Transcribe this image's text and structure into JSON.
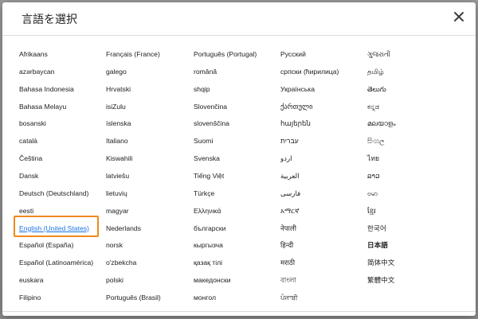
{
  "dialog": {
    "title": "言語を選択",
    "close_icon": "close-icon"
  },
  "colors": {
    "link": "#1a73e8",
    "highlight": "#f0891c",
    "text": "#202124"
  },
  "columns": [
    {
      "items": [
        {
          "label": "Afrikaans"
        },
        {
          "label": "azərbaycan"
        },
        {
          "label": "Bahasa Indonesia"
        },
        {
          "label": "Bahasa Melayu"
        },
        {
          "label": "bosanski"
        },
        {
          "label": "català"
        },
        {
          "label": "Čeština"
        },
        {
          "label": "Dansk"
        },
        {
          "label": "Deutsch (Deutschland)"
        },
        {
          "label": "eesti"
        },
        {
          "label": "English (United States)",
          "selected": true
        },
        {
          "label": "Español (España)"
        },
        {
          "label": "Español (Latinoamérica)"
        },
        {
          "label": "euskara"
        },
        {
          "label": "Filipino"
        }
      ]
    },
    {
      "items": [
        {
          "label": "Français (France)"
        },
        {
          "label": "galego"
        },
        {
          "label": "Hrvatski"
        },
        {
          "label": "isiZulu"
        },
        {
          "label": "íslenska"
        },
        {
          "label": "Italiano"
        },
        {
          "label": "Kiswahili"
        },
        {
          "label": "latviešu"
        },
        {
          "label": "lietuvių"
        },
        {
          "label": "magyar"
        },
        {
          "label": "Nederlands"
        },
        {
          "label": "norsk"
        },
        {
          "label": "o'zbekcha"
        },
        {
          "label": "polski"
        },
        {
          "label": "Português (Brasil)"
        }
      ]
    },
    {
      "items": [
        {
          "label": "Português (Portugal)"
        },
        {
          "label": "română"
        },
        {
          "label": "shqip"
        },
        {
          "label": "Slovenčina"
        },
        {
          "label": "slovenščina"
        },
        {
          "label": "Suomi"
        },
        {
          "label": "Svenska"
        },
        {
          "label": "Tiếng Việt"
        },
        {
          "label": "Türkçe"
        },
        {
          "label": "Ελληνικά"
        },
        {
          "label": "български"
        },
        {
          "label": "кыргызча"
        },
        {
          "label": "қазақ тілі"
        },
        {
          "label": "македонски"
        },
        {
          "label": "монгол"
        }
      ]
    },
    {
      "items": [
        {
          "label": "Русский"
        },
        {
          "label": "српски (ћирилица)"
        },
        {
          "label": "Українська"
        },
        {
          "label": "ქართული"
        },
        {
          "label": "հայերեն"
        },
        {
          "label": "עברית"
        },
        {
          "label": "اردو"
        },
        {
          "label": "العربية"
        },
        {
          "label": "فارسی"
        },
        {
          "label": "አማርኛ"
        },
        {
          "label": "नेपाली"
        },
        {
          "label": "हिन्दी"
        },
        {
          "label": "मराठी"
        },
        {
          "label": "বাংলা"
        },
        {
          "label": "ਪੰਜਾਬੀ"
        }
      ]
    },
    {
      "items": [
        {
          "label": "ગુજરાતી"
        },
        {
          "label": "தமிழ்"
        },
        {
          "label": "తెలుగు"
        },
        {
          "label": "ಕನ್ನಡ"
        },
        {
          "label": "മലയാളം"
        },
        {
          "label": "සිංහල"
        },
        {
          "label": "ไทย"
        },
        {
          "label": "ລາວ"
        },
        {
          "label": "ဗမာ"
        },
        {
          "label": "ខ្មែរ"
        },
        {
          "label": "한국어"
        },
        {
          "label": "日本語",
          "bold": true
        },
        {
          "label": "简体中文"
        },
        {
          "label": "繁體中文"
        }
      ]
    }
  ]
}
